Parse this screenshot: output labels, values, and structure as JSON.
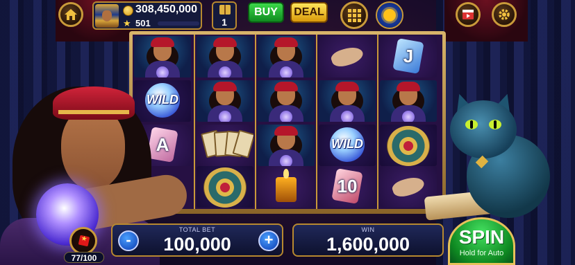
{
  "header": {
    "balance": "308,450,000",
    "level": "501",
    "collect_count": "1",
    "buy_label": "BUY",
    "deal_label": "DEAL"
  },
  "reels": [
    [
      "fortune-teller",
      "wild",
      "gem-a"
    ],
    [
      "fortune-teller",
      "fortune-teller",
      "tarot-cards",
      "zodiac-amulet"
    ],
    [
      "fortune-teller",
      "fortune-teller",
      "fortune-teller",
      "candle"
    ],
    [
      "palm-hand",
      "fortune-teller",
      "wild",
      "gem-ten"
    ],
    [
      "gem-j",
      "fortune-teller",
      "zodiac-amulet",
      "palm-hand"
    ]
  ],
  "symbols": {
    "wild_label": "WILD",
    "gem_a_label": "A",
    "gem_j_label": "J",
    "gem_ten_label": "10"
  },
  "meter": {
    "value": "77/100",
    "progress": 0.77
  },
  "bet": {
    "label": "TOTAL BET",
    "value": "100,000",
    "minus": "-",
    "plus": "+"
  },
  "win": {
    "label": "WIN",
    "value": "1,600,000"
  },
  "spin": {
    "label": "SPIN",
    "sublabel": "Hold for Auto"
  },
  "colors": {
    "gold_border": "#c99a3a",
    "buy_green": "#1fae2f",
    "deal_yellow": "#f2c426",
    "spin_green": "#1faa3a",
    "panel_navy": "#141a3c"
  }
}
